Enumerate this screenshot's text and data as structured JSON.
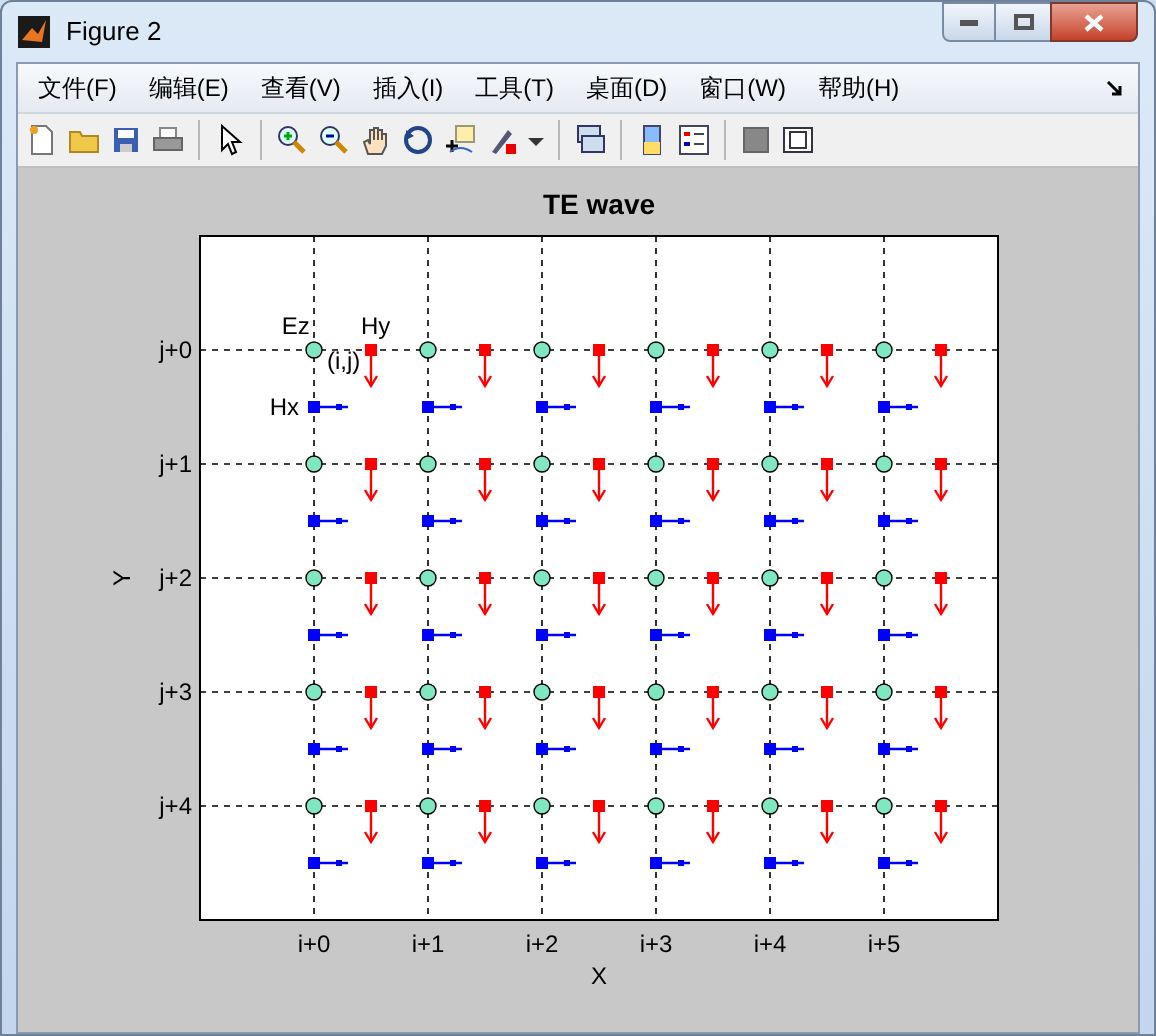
{
  "window": {
    "title": "Figure 2"
  },
  "menu": [
    "文件(F)",
    "编辑(E)",
    "查看(V)",
    "插入(I)",
    "工具(T)",
    "桌面(D)",
    "窗口(W)",
    "帮助(H)"
  ],
  "plot": {
    "title": "TE wave",
    "xlabel": "X",
    "ylabel": "Y",
    "x_labels": [
      "i+0",
      "i+1",
      "i+2",
      "i+3",
      "i+4",
      "i+5"
    ],
    "y_labels": [
      "j+0",
      "j+1",
      "j+2",
      "j+3",
      "j+4"
    ],
    "labels": [
      "Ez",
      "Hy",
      "(i,j)",
      "Hx"
    ]
  }
}
